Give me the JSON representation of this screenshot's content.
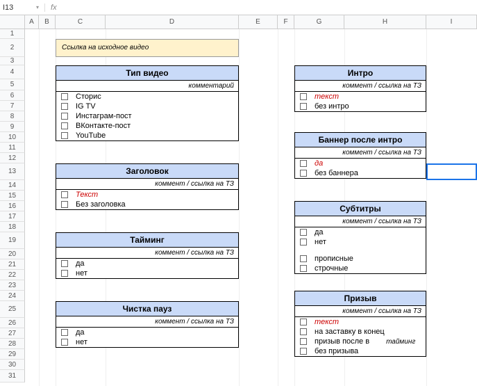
{
  "name_box": "I13",
  "fx": "fx",
  "cols": [
    "A",
    "B",
    "C",
    "D",
    "E",
    "F",
    "G",
    "H",
    "I"
  ],
  "rows": [
    1,
    2,
    3,
    4,
    5,
    6,
    7,
    8,
    9,
    10,
    11,
    12,
    13,
    14,
    15,
    16,
    17,
    18,
    19,
    20,
    21,
    22,
    23,
    24,
    25,
    26,
    27,
    28,
    29,
    30,
    31
  ],
  "source_link": "Ссылка на исходное видео",
  "video_type": {
    "title": "Тип видео",
    "sub": "комментарий",
    "items": [
      "Сторис",
      "IG TV",
      "Инстаграм-пост",
      "ВКонтакте-пост",
      "YouTube"
    ]
  },
  "headline": {
    "title": "Заголовок",
    "sub": "коммент / ссылка на ТЗ",
    "items_red": [
      "Текст"
    ],
    "items": [
      "Без заголовка"
    ]
  },
  "timing": {
    "title": "Тайминг",
    "sub": "коммент / ссылка на ТЗ",
    "items": [
      "да",
      "нет"
    ]
  },
  "pause_clean": {
    "title": "Чистка пауз",
    "sub": "коммент / ссылка на ТЗ",
    "items": [
      "да",
      "нет"
    ]
  },
  "intro": {
    "title": "Интро",
    "sub": "коммент / ссылка на ТЗ",
    "items_red": [
      "текст"
    ],
    "items": [
      "без интро"
    ]
  },
  "post_banner": {
    "title": "Баннер после интро",
    "sub": "коммент / ссылка на ТЗ",
    "items_red": [
      "да"
    ],
    "items": [
      "без баннера"
    ]
  },
  "subtitles": {
    "title": "Субтитры",
    "sub": "коммент / ссылка на ТЗ",
    "items1": [
      "да",
      "нет"
    ],
    "items2": [
      "прописные",
      "строчные"
    ]
  },
  "call": {
    "title": "Призыв",
    "sub": "коммент / ссылка на ТЗ",
    "items_red": [
      "текст"
    ],
    "items": [
      "на заставку в конец",
      "призыв после в",
      "без призыва"
    ],
    "extra": "тайминг"
  }
}
